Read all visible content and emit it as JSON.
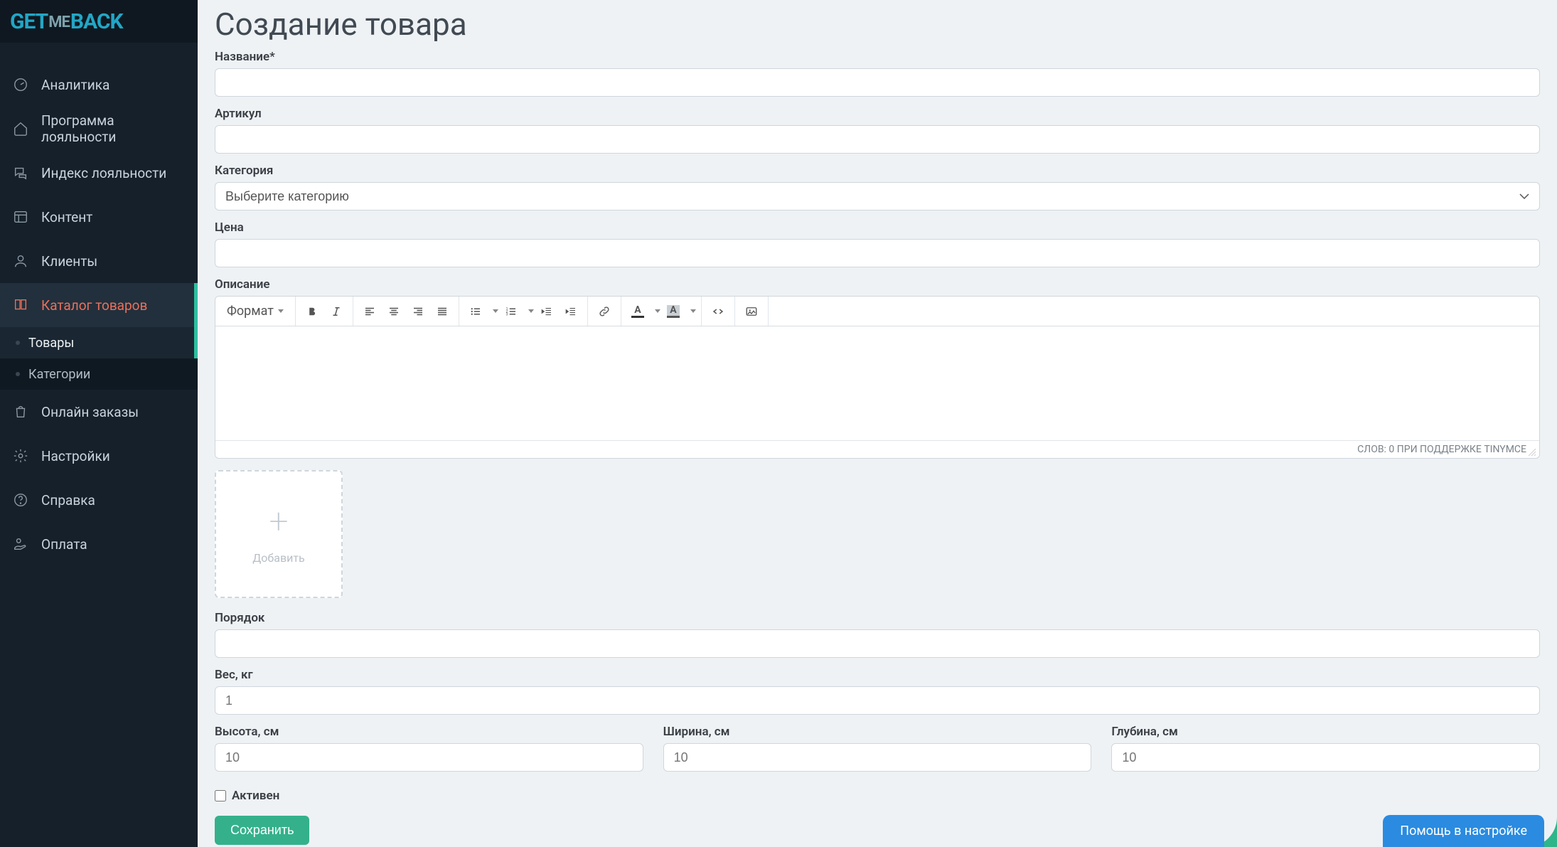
{
  "logo": {
    "part1": "GET",
    "part2": "ME",
    "part3": "BACK"
  },
  "sidebar": {
    "items": [
      {
        "label": "Аналитика"
      },
      {
        "label": "Программа лояльности"
      },
      {
        "label": "Индекс лояльности"
      },
      {
        "label": "Контент"
      },
      {
        "label": "Клиенты"
      },
      {
        "label": "Каталог товаров"
      },
      {
        "label": "Онлайн заказы"
      },
      {
        "label": "Настройки"
      },
      {
        "label": "Справка"
      },
      {
        "label": "Оплата"
      }
    ],
    "sub": [
      {
        "label": "Товары"
      },
      {
        "label": "Категории"
      }
    ]
  },
  "page": {
    "title": "Создание товара",
    "labels": {
      "name": "Название*",
      "sku": "Артикул",
      "category": "Категория",
      "category_placeholder": "Выберите категорию",
      "price": "Цена",
      "description": "Описание",
      "order": "Порядок",
      "weight": "Вес, кг",
      "weight_placeholder": "1",
      "height": "Высота, см",
      "height_placeholder": "10",
      "width": "Ширина, см",
      "width_placeholder": "10",
      "depth": "Глубина, см",
      "depth_placeholder": "10",
      "active": "Активен",
      "add_image": "Добавить"
    },
    "editor": {
      "format_label": "Формат",
      "status": "СЛОВ: 0 ПРИ ПОДДЕРЖКЕ TINYMCE"
    },
    "save": "Сохранить"
  },
  "help_widget": "Помощь в настройке"
}
